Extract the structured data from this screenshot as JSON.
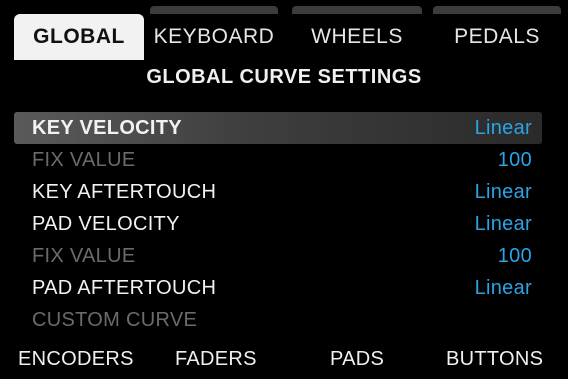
{
  "tabs": [
    {
      "label": "GLOBAL",
      "active": true
    },
    {
      "label": "KEYBOARD",
      "active": false
    },
    {
      "label": "WHEELS",
      "active": false
    },
    {
      "label": "PEDALS",
      "active": false
    }
  ],
  "section_title": "GLOBAL CURVE SETTINGS",
  "settings": [
    {
      "label": "KEY VELOCITY",
      "value": "Linear",
      "selected": true,
      "dimmed": false
    },
    {
      "label": "FIX VALUE",
      "value": "100",
      "selected": false,
      "dimmed": true
    },
    {
      "label": "KEY AFTERTOUCH",
      "value": "Linear",
      "selected": false,
      "dimmed": false
    },
    {
      "label": "PAD VELOCITY",
      "value": "Linear",
      "selected": false,
      "dimmed": false
    },
    {
      "label": "FIX VALUE",
      "value": "100",
      "selected": false,
      "dimmed": true
    },
    {
      "label": "PAD AFTERTOUCH",
      "value": "Linear",
      "selected": false,
      "dimmed": false
    },
    {
      "label": "CUSTOM CURVE",
      "value": "",
      "selected": false,
      "dimmed": true
    }
  ],
  "bottom_nav": [
    "ENCODERS",
    "FADERS",
    "PADS",
    "BUTTONS"
  ],
  "colors": {
    "background": "#000000",
    "value_blue": "#2aa4e6",
    "dim_text": "#6b6b6b",
    "active_tab_bg": "#f2f2f2"
  }
}
